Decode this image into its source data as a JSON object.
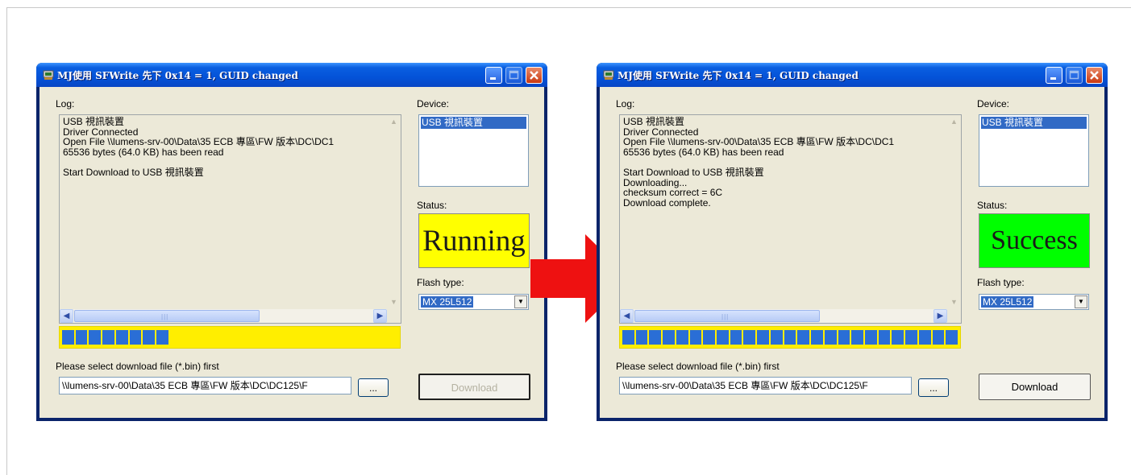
{
  "windows": [
    {
      "title": "MJ使用 SFWrite 先下 0x14 = 1, GUID changed",
      "log_label": "Log:",
      "log_lines": [
        "USB 視訊裝置",
        "Driver Connected",
        "Open File \\\\lumens-srv-00\\Data\\35 ECB 專區\\FW 版本\\DC\\DC1",
        "65536 bytes (64.0 KB) has been read",
        "",
        "Start Download to USB 視訊裝置"
      ],
      "progress": {
        "blocks_filled": 8,
        "blocks_total": 25,
        "color": "#ffee00"
      },
      "device_label": "Device:",
      "device_item": "USB 視訊裝置",
      "status_label": "Status:",
      "status_text": "Running",
      "status_color": "#ffff00",
      "flash_label": "Flash type:",
      "flash_value": "MX 25L512",
      "select_label": "Please select download file (*.bin) first",
      "path_value": "\\\\lumens-srv-00\\Data\\35 ECB 專區\\FW 版本\\DC\\DC125\\F",
      "browse_label": "...",
      "download_label": "Download",
      "download_enabled": false
    },
    {
      "title": "MJ使用 SFWrite 先下 0x14 = 1, GUID changed",
      "log_label": "Log:",
      "log_lines": [
        "USB 視訊裝置",
        "Driver Connected",
        "Open File \\\\lumens-srv-00\\Data\\35 ECB 專區\\FW 版本\\DC\\DC1",
        "65536 bytes (64.0 KB) has been read",
        "",
        "Start Download to USB 視訊裝置",
        "Downloading...",
        "checksum correct = 6C",
        "Download complete."
      ],
      "progress": {
        "blocks_filled": 25,
        "blocks_total": 25,
        "color": "#ffee00"
      },
      "device_label": "Device:",
      "device_item": "USB 視訊裝置",
      "status_label": "Status:",
      "status_text": "Success",
      "status_color": "#00ff00",
      "flash_label": "Flash type:",
      "flash_value": "MX 25L512",
      "select_label": "Please select download file (*.bin) first",
      "path_value": "\\\\lumens-srv-00\\Data\\35 ECB 專區\\FW 版本\\DC\\DC125\\F",
      "browse_label": "...",
      "download_label": "Download",
      "download_enabled": true
    }
  ],
  "arrow_color": "#ee1111"
}
